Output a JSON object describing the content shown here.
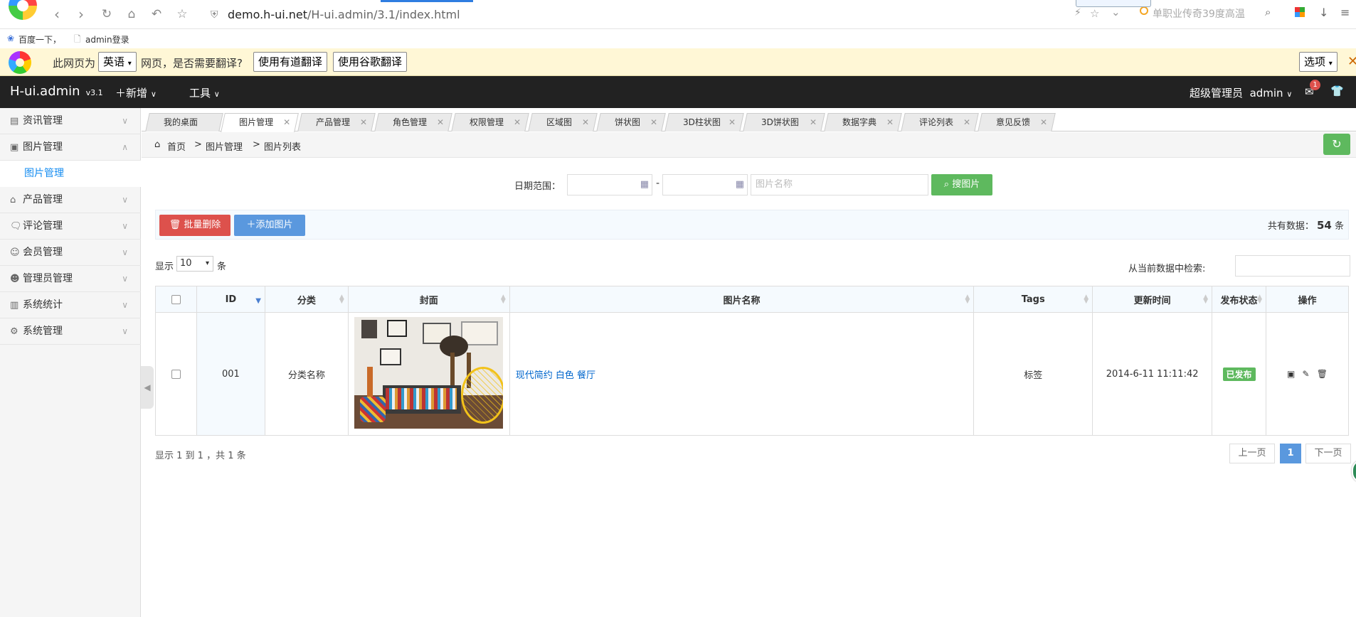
{
  "browser": {
    "url_host": "demo.h-ui.net",
    "url_path": "/H-ui.admin/3.1/index.html",
    "search_hint": "单职业传奇39度高温",
    "bookmarks": [
      "百度一下，",
      "admin登录"
    ]
  },
  "translate_bar": {
    "prefix": "此网页为",
    "language": "英语",
    "question": "网页，是否需要翻译?",
    "youdao": "使用有道翻译",
    "google": "使用谷歌翻译",
    "options": "选项"
  },
  "header": {
    "brand": "H-ui.admin",
    "version": "v3.1",
    "add_menu": "新增",
    "tools_menu": "工具",
    "role": "超级管理员",
    "user": "admin",
    "message_count": "1"
  },
  "sidebar": {
    "items": [
      {
        "label": "资讯管理",
        "icon": "news-icon"
      },
      {
        "label": "图片管理",
        "icon": "image-icon"
      },
      {
        "label": "产品管理",
        "icon": "product-icon"
      },
      {
        "label": "评论管理",
        "icon": "comment-icon"
      },
      {
        "label": "会员管理",
        "icon": "member-icon"
      },
      {
        "label": "管理员管理",
        "icon": "admin-icon"
      },
      {
        "label": "系统统计",
        "icon": "stats-icon"
      },
      {
        "label": "系统管理",
        "icon": "settings-icon"
      }
    ],
    "sub_item": "图片管理"
  },
  "tabs": [
    "我的桌面",
    "图片管理",
    "产品管理",
    "角色管理",
    "权限管理",
    "区域图",
    "饼状图",
    "3D柱状图",
    "3D饼状图",
    "数据字典",
    "评论列表",
    "意见反馈"
  ],
  "breadcrumb": {
    "home": "首页",
    "section": "图片管理",
    "page": "图片列表",
    "sep": ">"
  },
  "search": {
    "date_label": "日期范围：",
    "dash": "-",
    "name_placeholder": "图片名称",
    "button": "搜图片"
  },
  "toolbar": {
    "batch_delete": "批量删除",
    "add_image": "添加图片",
    "total_prefix": "共有数据：",
    "total_count": "54",
    "total_suffix": "条"
  },
  "list_controls": {
    "show_label": "显示",
    "page_size": "10",
    "unit": "条",
    "filter_label": "从当前数据中检索:"
  },
  "table": {
    "headers": [
      "ID",
      "分类",
      "封面",
      "图片名称",
      "Tags",
      "更新时间",
      "发布状态",
      "操作"
    ],
    "rows": [
      {
        "id": "001",
        "category": "分类名称",
        "name": "现代简约 白色 餐厅",
        "tags": "标签",
        "updated": "2014-6-11 11:11:42",
        "status": "已发布"
      }
    ]
  },
  "pagination": {
    "info": "显示 1 到 1 ，共 1 条",
    "prev": "上一页",
    "current": "1",
    "next": "下一页"
  },
  "colors": {
    "accent_blue": "#5a98de",
    "success": "#5eb95e",
    "danger": "#dd514c",
    "header_bg": "#222222"
  }
}
